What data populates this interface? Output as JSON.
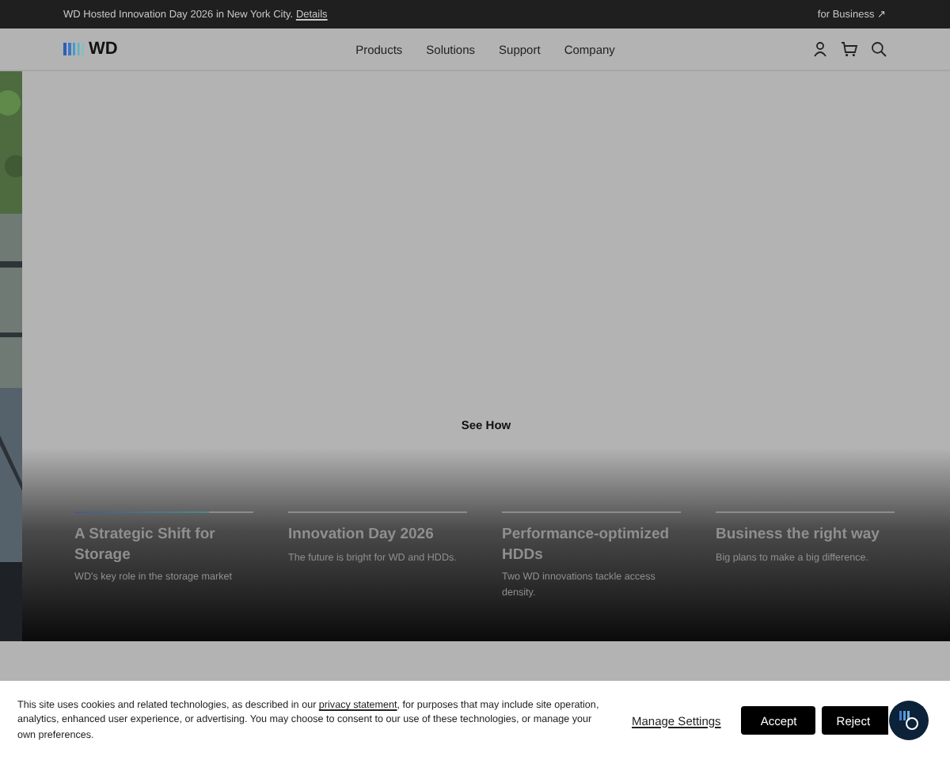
{
  "announcement": {
    "text": "WD Hosted Innovation Day 2026 in New York City.",
    "link": "Details",
    "business_link": "for Business ↗"
  },
  "nav": {
    "logo": "WD",
    "items": [
      "Products",
      "Solutions",
      "Support",
      "Company"
    ]
  },
  "hero": {
    "cta": "See How",
    "cards": [
      {
        "title": "A Strategic Shift for Storage",
        "subtitle": "WD's key role in the storage market",
        "level": 0.75
      },
      {
        "title": "Innovation Day 2026",
        "subtitle": "The future is bright for WD and HDDs."
      },
      {
        "title": "Performance-optimized HDDs",
        "subtitle": "Two WD innovations tackle access density."
      },
      {
        "title": "Business the right way",
        "subtitle": "Big plans to make a big difference."
      }
    ]
  },
  "cookie_banner": {
    "text_before": "This site uses cookies and related technologies, as described in our",
    "link": "privacy statement",
    "text_after": ", for purposes that may include site operation, analytics, enhanced user experience, or advertising. You may choose to consent to our use of these technologies, or manage your own preferences.",
    "manage": "Manage Settings",
    "accept": "Accept",
    "reject": "Reject"
  }
}
